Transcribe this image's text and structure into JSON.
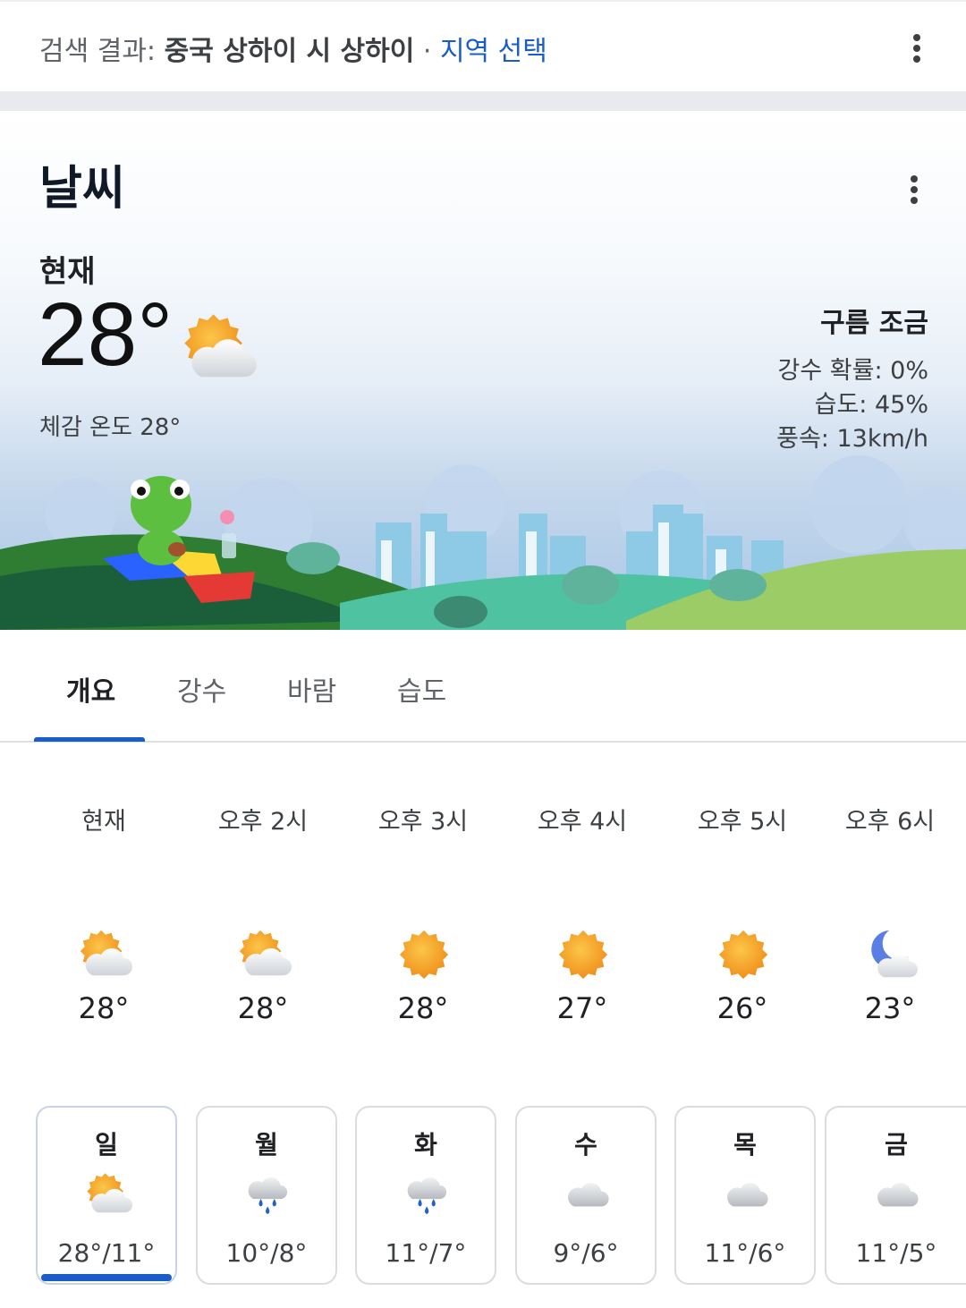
{
  "search": {
    "prefix": "검색 결과: ",
    "location": "중국 상하이 시 상하이",
    "separator": " · ",
    "choose_region": "지역 선택"
  },
  "weather": {
    "title": "날씨",
    "now_label": "현재",
    "temperature": "28°",
    "feels_like": "체감 온도 28°",
    "condition": "구름 조금",
    "precipitation": "강수 확률: 0%",
    "humidity": "습도: 45%",
    "wind": "풍속: 13km/h",
    "icon": "partly-cloudy-icon"
  },
  "tabs": [
    {
      "label": "개요",
      "active": true
    },
    {
      "label": "강수",
      "active": false
    },
    {
      "label": "바람",
      "active": false
    },
    {
      "label": "습도",
      "active": false
    }
  ],
  "hourly": [
    {
      "time": "현재",
      "temp": "28°",
      "icon": "partly-cloudy-icon"
    },
    {
      "time": "오후 2시",
      "temp": "28°",
      "icon": "partly-cloudy-icon"
    },
    {
      "time": "오후 3시",
      "temp": "28°",
      "icon": "sun-icon"
    },
    {
      "time": "오후 4시",
      "temp": "27°",
      "icon": "sun-icon"
    },
    {
      "time": "오후 5시",
      "temp": "26°",
      "icon": "sun-icon"
    },
    {
      "time": "오후 6시",
      "temp": "23°",
      "icon": "moon-cloud-icon"
    }
  ],
  "daily": [
    {
      "day": "일",
      "temps": "28°/11°",
      "icon": "partly-cloudy-icon",
      "selected": true
    },
    {
      "day": "월",
      "temps": "10°/8°",
      "icon": "rain-icon"
    },
    {
      "day": "화",
      "temps": "11°/7°",
      "icon": "rain-icon"
    },
    {
      "day": "수",
      "temps": "9°/6°",
      "icon": "cloud-icon"
    },
    {
      "day": "목",
      "temps": "11°/6°",
      "icon": "cloud-icon"
    },
    {
      "day": "금",
      "temps": "11°/5°",
      "icon": "cloud-icon"
    }
  ],
  "colors": {
    "accent": "#1a5cc8",
    "sun": "#f5a623",
    "cloud": "#e8eaed"
  }
}
